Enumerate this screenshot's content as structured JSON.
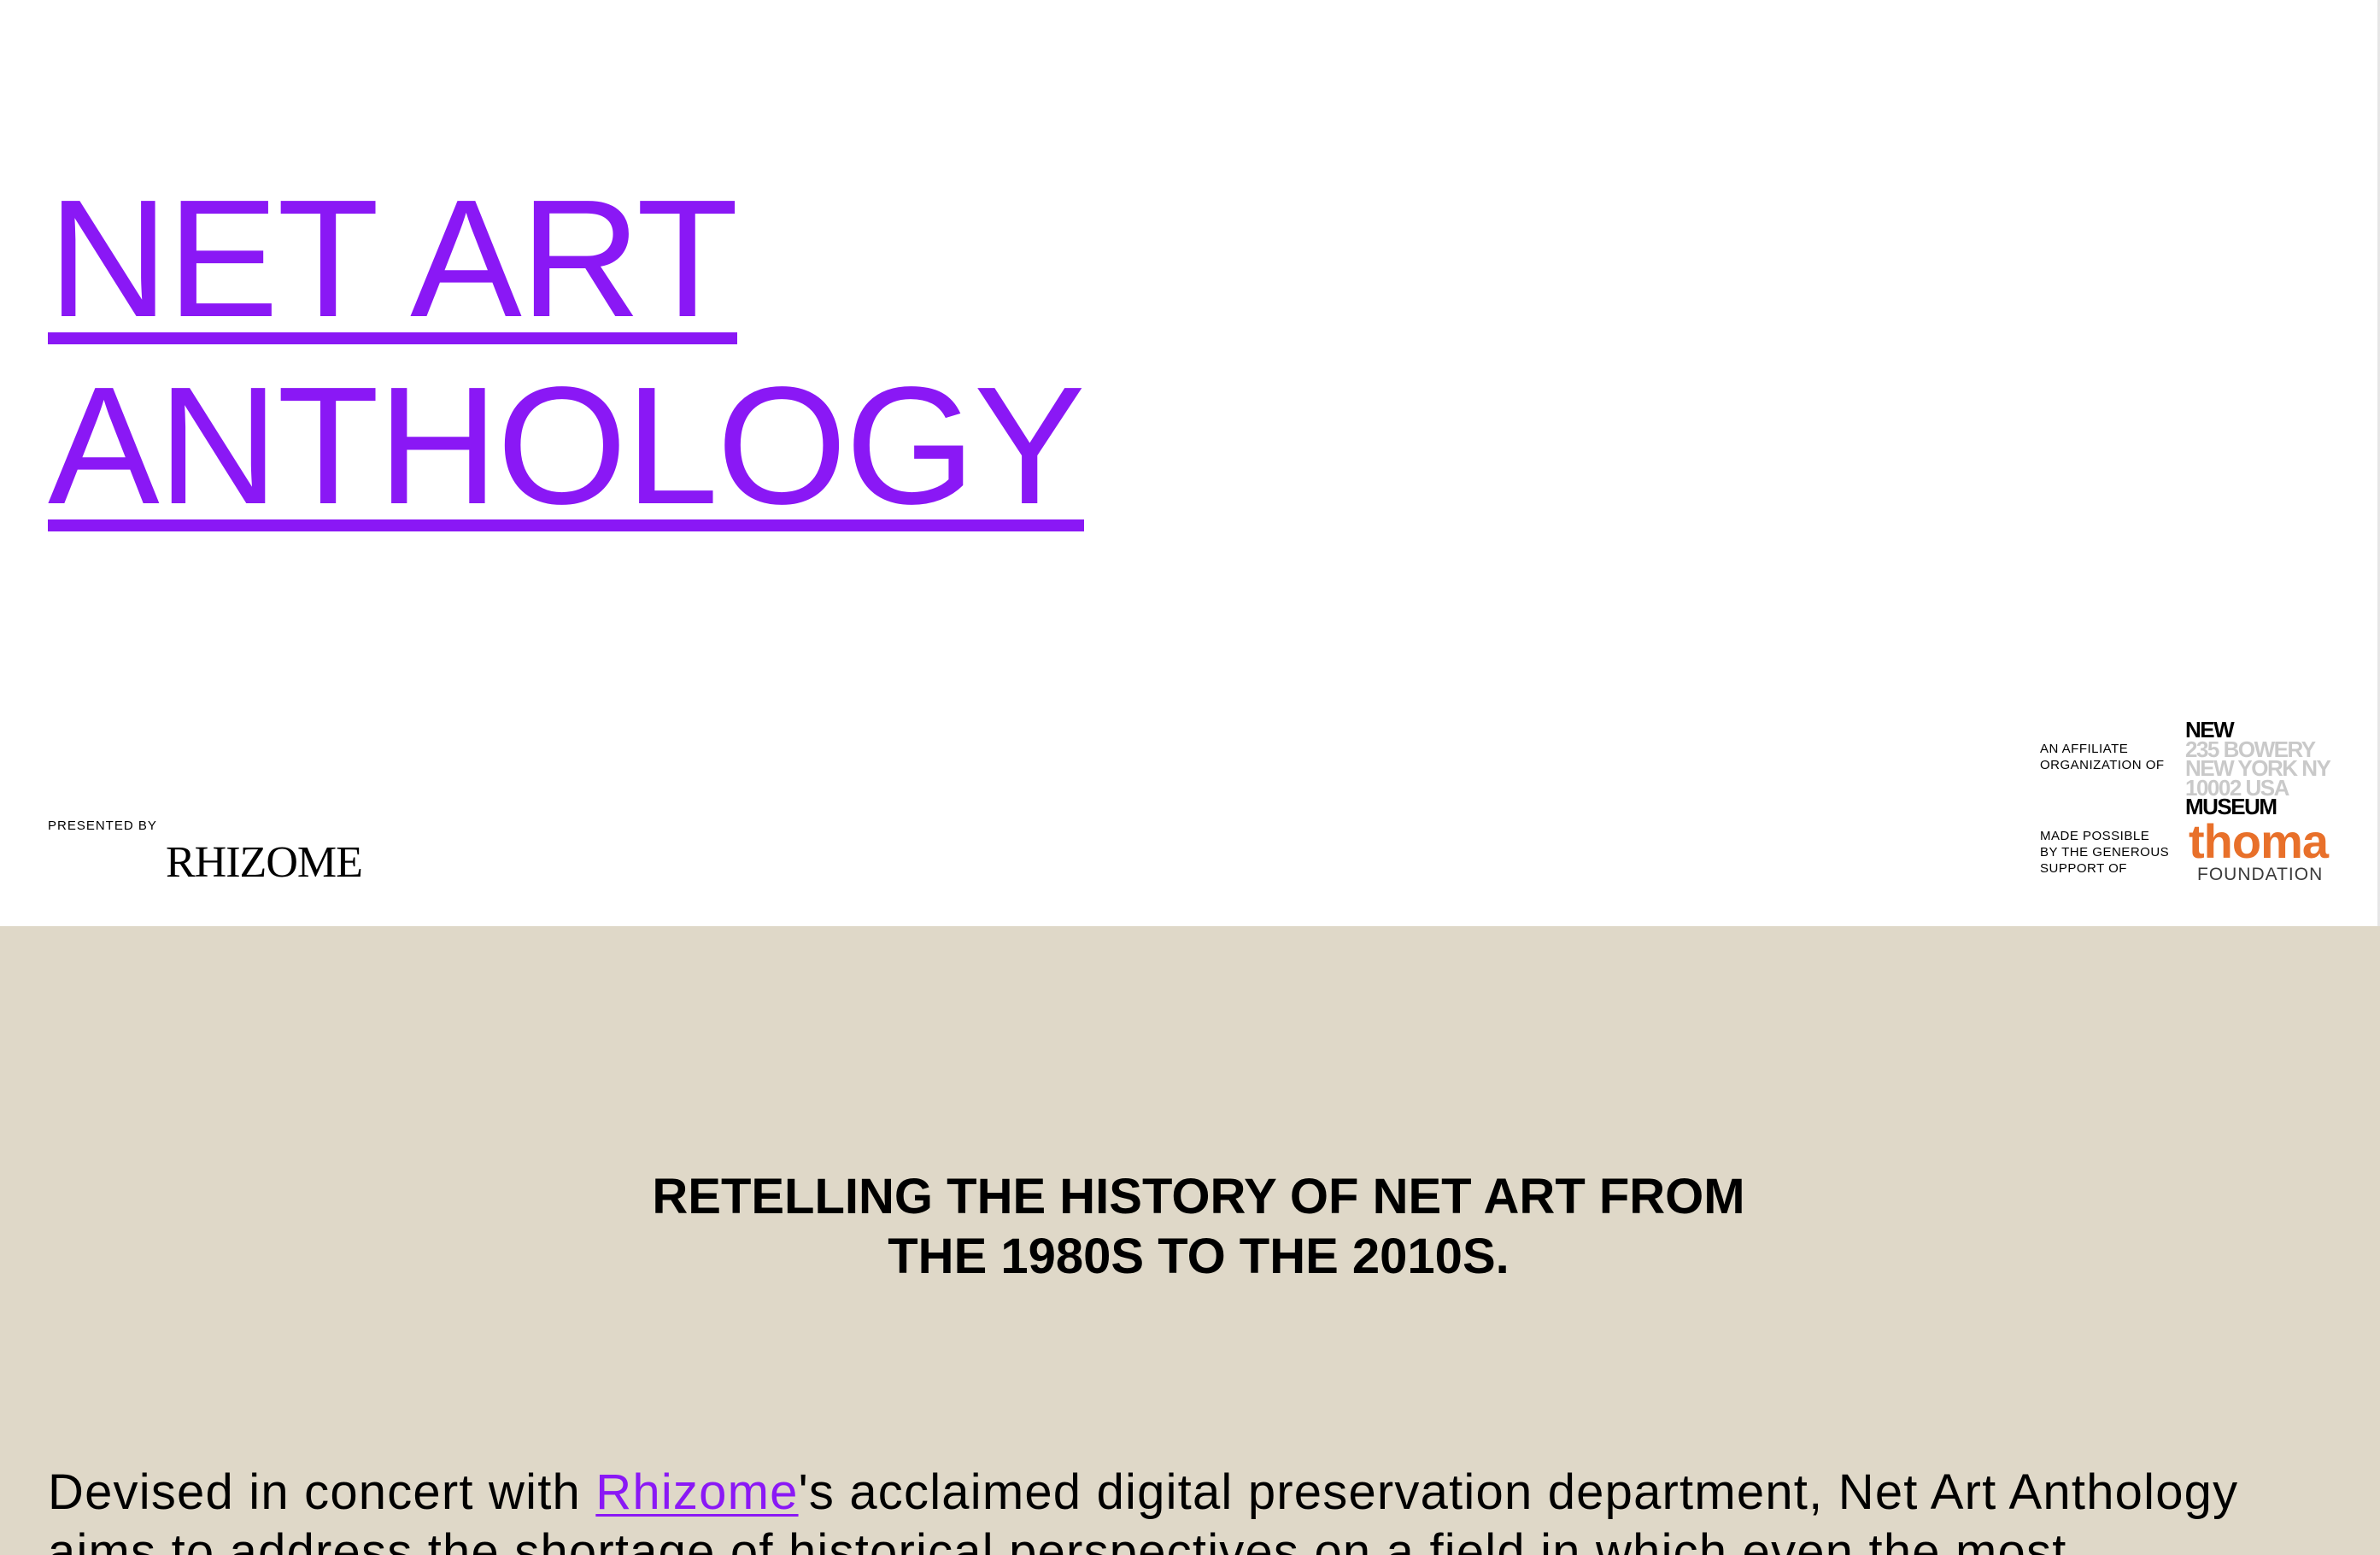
{
  "header": {
    "title_line1": "NET ART",
    "title_line2": "ANTHOLOGY",
    "presented_by": "PRESENTED BY",
    "presenter_logo_text": "RHIZOME",
    "affiliate_label": "AN AFFILIATE\nORGANIZATION OF",
    "new_museum_logo": {
      "line1": "NEW",
      "line2": "235 BOWERY",
      "line3": "NEW YORK NY",
      "line4": "10002 USA",
      "line5": "MUSEUM"
    },
    "support_label": "MADE POSSIBLE\nBY THE GENEROUS\nSUPPORT OF",
    "thoma_logo": {
      "word": "thoma",
      "sub": "FOUNDATION"
    }
  },
  "intro": {
    "tagline_line1": "RETELLING THE HISTORY OF NET ART FROM",
    "tagline_line2": "THE 1980S TO THE 2010S.",
    "body_before_link": "Devised in concert with ",
    "body_link": "Rhizome",
    "body_after_link": "'s acclaimed digital preservation department, Net Art Anthology aims to address the shortage of historical perspectives on a field in which even the most"
  },
  "colors": {
    "accent_purple": "#8a18f5",
    "intro_background": "#dfd8c8",
    "thoma_orange": "#e8702a",
    "museum_grey": "#c9c9c9"
  }
}
